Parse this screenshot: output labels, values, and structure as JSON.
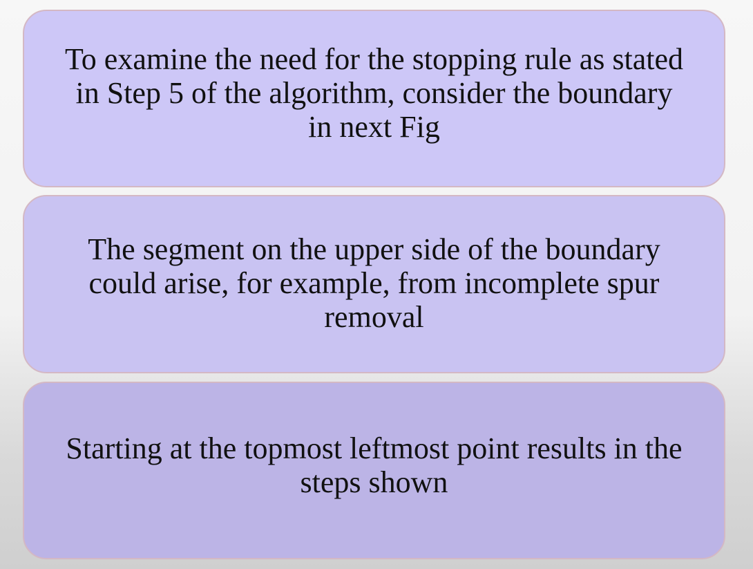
{
  "boxes": [
    {
      "text": "To examine the need for the stopping rule as stated\nin Step 5 of the algorithm, consider the boundary\nin next Fig"
    },
    {
      "text": "The segment on the upper side of the boundary\ncould arise, for example, from incomplete spur\nremoval"
    },
    {
      "text": "Starting at the topmost leftmost point results in the\nsteps shown"
    }
  ],
  "colors": {
    "box_1_fill": "#cdc7f7",
    "box_2_fill": "#c9c3f2",
    "box_3_fill": "#bcb4e6",
    "box_border": "#d4b8c4",
    "text": "#111111"
  }
}
